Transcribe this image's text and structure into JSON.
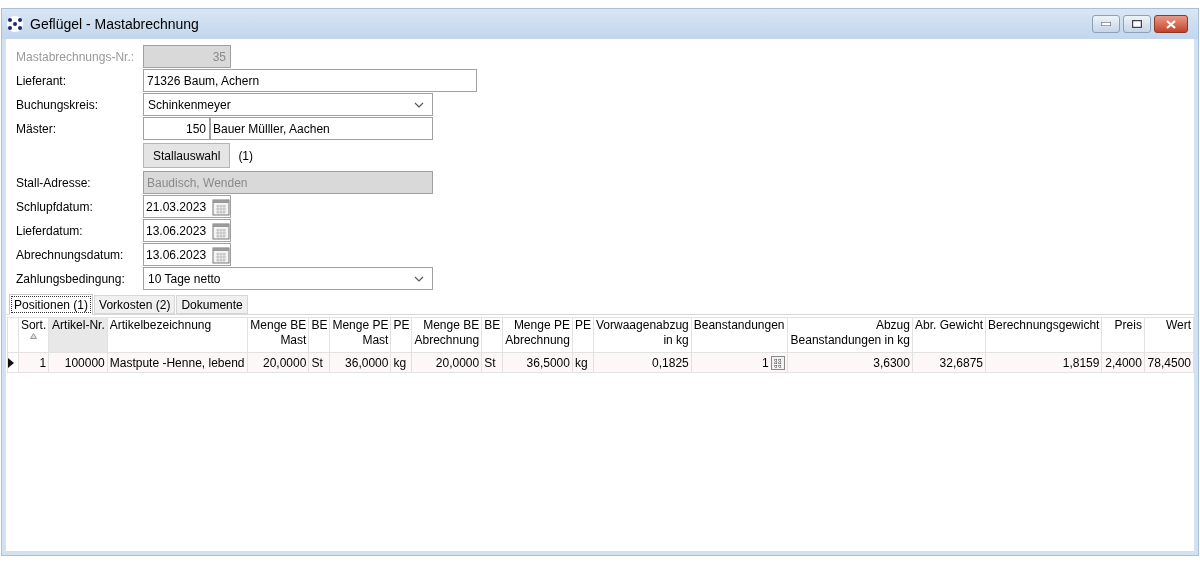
{
  "window": {
    "title": "Geflügel - Mastabrechnung"
  },
  "form": [
    {
      "label": "Mastabrechnungs-Nr.:",
      "kind": "number",
      "value": "35",
      "disabled": true
    },
    {
      "label": "Lieferant:",
      "kind": "text",
      "value": "71326 Baum, Achern",
      "disabled": false
    },
    {
      "label": "Buchungskreis:",
      "kind": "combo",
      "value": "Schinkenmeyer",
      "disabled": false
    },
    {
      "label": "Mäster:",
      "kind": "pair",
      "number": "150",
      "value": "Bauer Mülller, Aachen",
      "disabled": false
    },
    {
      "kind": "button",
      "button": "Stallauswahl",
      "note": "(1)"
    },
    {
      "label": "Stall-Adresse:",
      "kind": "text",
      "value": "Baudisch, Wenden",
      "disabled": true
    },
    {
      "label": "Schlupfdatum:",
      "kind": "date",
      "value": "21.03.2023",
      "disabled": false
    },
    {
      "label": "Lieferdatum:",
      "kind": "date",
      "value": "13.06.2023",
      "disabled": false
    },
    {
      "label": "Abrechnungsdatum:",
      "kind": "date",
      "value": "13.06.2023",
      "disabled": false
    },
    {
      "label": "Zahlungsbedingung:",
      "kind": "combo",
      "value": "10 Tage netto",
      "disabled": false
    }
  ],
  "tabs": [
    {
      "label": "Positionen (1)",
      "selected": true
    },
    {
      "label": "Vorkosten (2)",
      "selected": false
    },
    {
      "label": "Dokumente",
      "selected": false
    }
  ],
  "table": {
    "columns": [
      {
        "lines": [
          "Sort."
        ],
        "sorted": true,
        "highlighted": false
      },
      {
        "lines": [
          "Artikel-Nr."
        ],
        "sorted": false,
        "highlighted": true
      },
      {
        "lines": [
          "Artikelbezeichnung"
        ],
        "sorted": false,
        "highlighted": false
      },
      {
        "lines": [
          "Menge BE",
          "Mast"
        ],
        "sorted": false,
        "highlighted": false
      },
      {
        "lines": [
          "BE"
        ],
        "sorted": false,
        "highlighted": false
      },
      {
        "lines": [
          "Menge PE",
          "Mast"
        ],
        "sorted": false,
        "highlighted": false
      },
      {
        "lines": [
          "PE"
        ],
        "sorted": false,
        "highlighted": false
      },
      {
        "lines": [
          "Menge BE",
          "Abrechnung"
        ],
        "sorted": false,
        "highlighted": false
      },
      {
        "lines": [
          "BE"
        ],
        "sorted": false,
        "highlighted": false
      },
      {
        "lines": [
          "Menge PE",
          "Abrechnung"
        ],
        "sorted": false,
        "highlighted": false
      },
      {
        "lines": [
          "PE"
        ],
        "sorted": false,
        "highlighted": false
      },
      {
        "lines": [
          "Vorwaagenabzug",
          "in kg"
        ],
        "sorted": false,
        "highlighted": false
      },
      {
        "lines": [
          "Beanstandungen"
        ],
        "sorted": false,
        "highlighted": false
      },
      {
        "lines": [
          "Abzug",
          "Beanstandungen in kg"
        ],
        "sorted": false,
        "highlighted": false
      },
      {
        "lines": [
          "Abr. Gewicht"
        ],
        "sorted": false,
        "highlighted": false
      },
      {
        "lines": [
          "Berechnungsgewicht"
        ],
        "sorted": false,
        "highlighted": false
      },
      {
        "lines": [
          "Preis"
        ],
        "sorted": false,
        "highlighted": false
      },
      {
        "lines": [
          "Wert"
        ],
        "sorted": false,
        "highlighted": false
      }
    ],
    "rows": [
      {
        "current": true,
        "cells": [
          "1",
          "100000",
          "Mastpute -Henne, lebend",
          "20,0000",
          "St",
          "36,0000",
          "kg",
          "20,0000",
          "St",
          "36,5000",
          "kg",
          "0,1825",
          "1",
          "3,6300",
          "32,6875",
          "1,8159",
          "2,4000",
          "78,4500"
        ]
      }
    ]
  }
}
